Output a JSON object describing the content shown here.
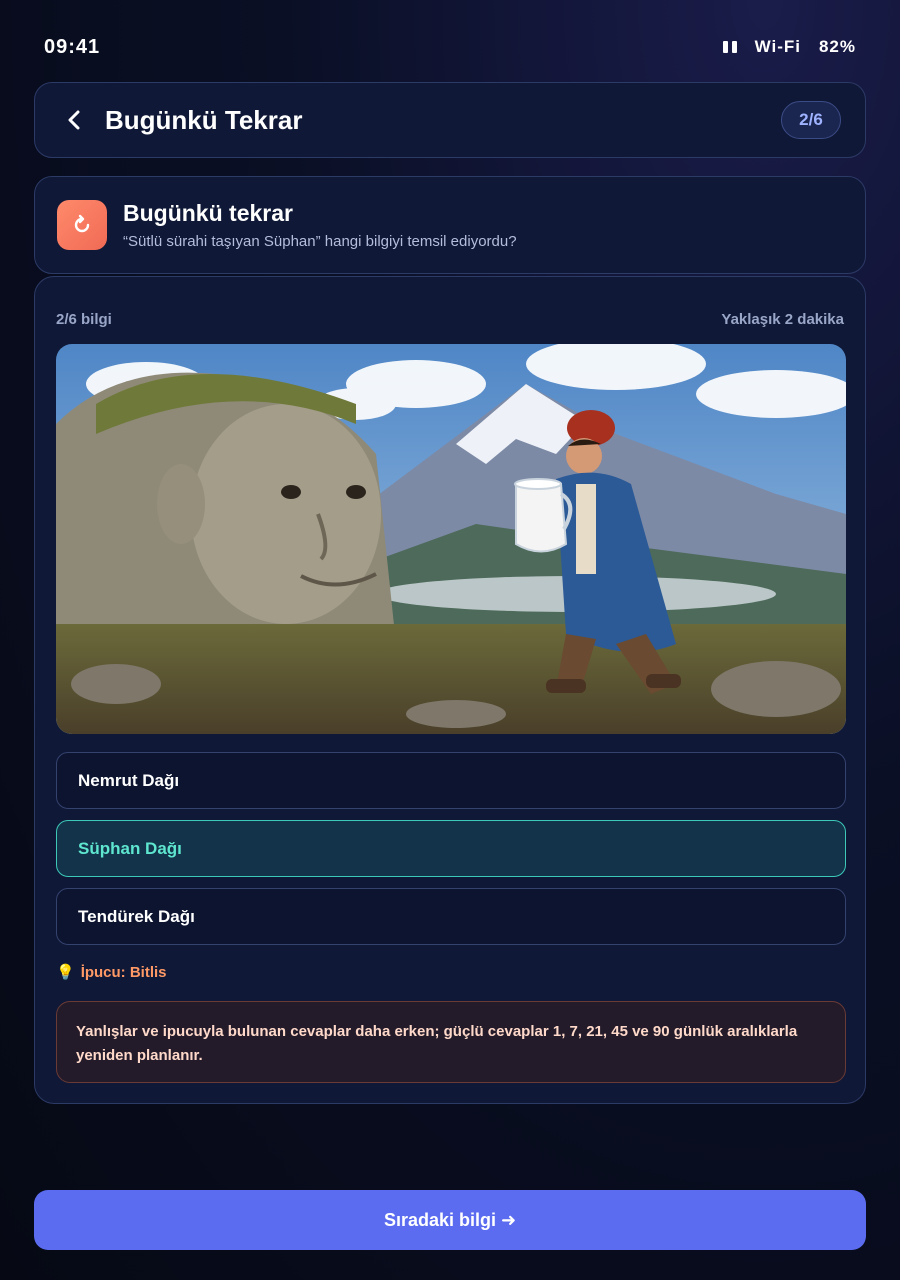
{
  "status_bar": {
    "time": "09:41",
    "wifi": "Wi-Fi",
    "battery": "82%"
  },
  "header": {
    "title": "Bugünkü Tekrar",
    "badge": "2/6"
  },
  "intro": {
    "icon": "refresh-icon",
    "title": "Bugünkü tekrar",
    "subtitle": "“Sütlü sürahi taşıyan Süphan” hangi bilgiyi temsil ediyordu?"
  },
  "card": {
    "progress": "2/6 bilgi",
    "duration": "Yaklaşık 2 dakika",
    "options": [
      {
        "label": "Nemrut Dağı",
        "selected": false
      },
      {
        "label": "Süphan Dağı",
        "selected": true
      },
      {
        "label": "Tendürek Dağı",
        "selected": false
      }
    ],
    "hint_icon": "💡",
    "hint": "İpucu: Bitlis",
    "info": "Yanlışlar ve ipucuyla bulunan cevaplar daha erken; güçlü cevaplar 1, 7, 21, 45 ve 90 günlük aralıklarla yeniden planlanır."
  },
  "footer": {
    "next_button": "Sıradaki bilgi ➜"
  },
  "colors": {
    "accent": "#5b6cf0",
    "selected": "#5ee6cf",
    "hint": "#ff9966",
    "icon_bg": "#f06a55"
  }
}
